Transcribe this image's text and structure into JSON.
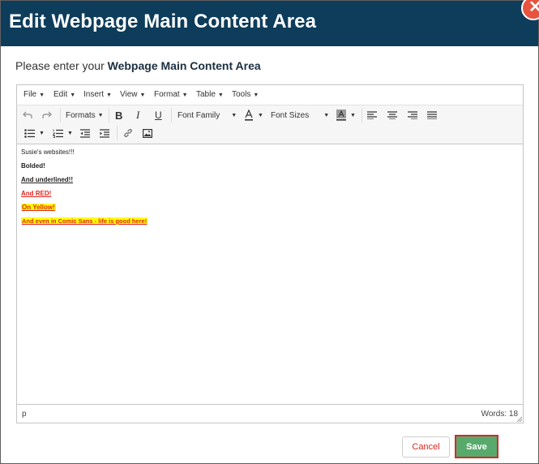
{
  "dialog": {
    "title": "Edit Webpage Main Content Area",
    "close_glyph": "✕"
  },
  "prompt": {
    "prefix": "Please enter your",
    "field_name": "Webpage Main Content Area"
  },
  "menubar": {
    "items": [
      "File",
      "Edit",
      "Insert",
      "View",
      "Format",
      "Table",
      "Tools"
    ]
  },
  "toolbar": {
    "formats_label": "Formats",
    "font_family_label": "Font Family",
    "font_sizes_label": "Font Sizes",
    "icons": [
      "undo-icon",
      "redo-icon",
      "bold-icon",
      "italic-icon",
      "underline-icon",
      "text-color-icon",
      "background-color-icon",
      "align-left-icon",
      "align-center-icon",
      "align-right-icon",
      "justify-icon",
      "bullet-list-icon",
      "numbered-list-icon",
      "outdent-icon",
      "indent-icon",
      "link-icon",
      "image-icon"
    ]
  },
  "content": {
    "lines": [
      "Susie's websites!!!",
      "Bolded!",
      "And underlined!!",
      "And RED!",
      "On Yellow!",
      "And even in Comic Sans - life is good here!"
    ]
  },
  "statusbar": {
    "path": "p",
    "word_count": "Words: 18"
  },
  "buttons": {
    "cancel": "Cancel",
    "save": "Save"
  },
  "colors": {
    "title_bar": "#0e3c5b",
    "close": "#e8533f",
    "save": "#58aa6c",
    "save_border": "#e0242b",
    "red_text": "#e0241b",
    "highlight": "#ffff00"
  }
}
